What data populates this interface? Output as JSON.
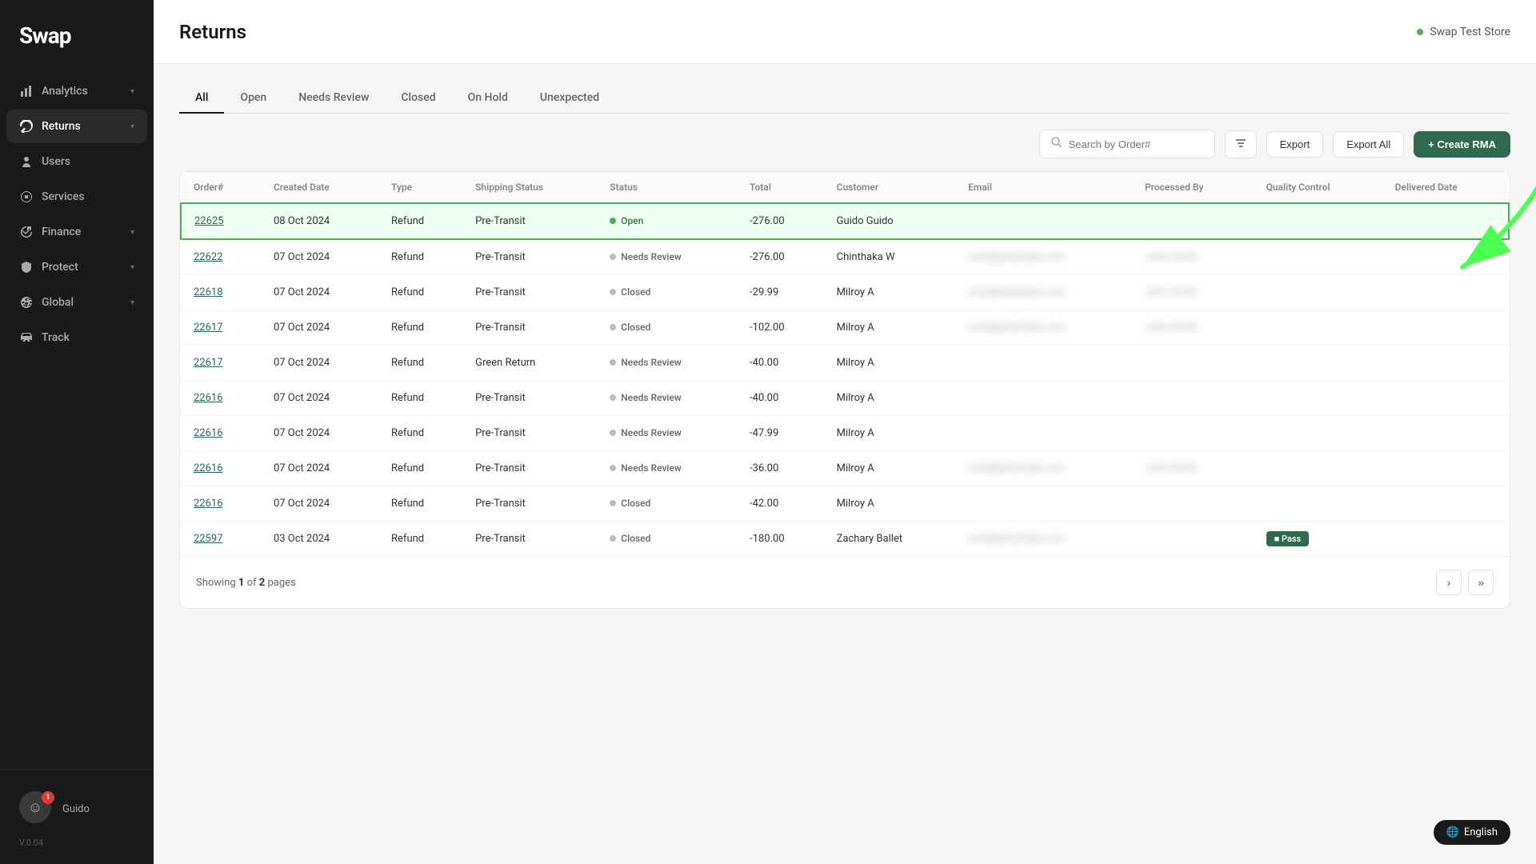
{
  "sidebar": {
    "logo": "Swap",
    "items": [
      {
        "id": "analytics",
        "label": "Analytics",
        "icon": "chart-bar",
        "hasChevron": true
      },
      {
        "id": "returns",
        "label": "Returns",
        "icon": "returns",
        "hasChevron": true,
        "active": true
      },
      {
        "id": "users",
        "label": "Users",
        "icon": "users",
        "hasChevron": false
      },
      {
        "id": "services",
        "label": "Services",
        "icon": "services",
        "hasChevron": false
      },
      {
        "id": "finance",
        "label": "Finance",
        "icon": "finance",
        "hasChevron": true
      },
      {
        "id": "protect",
        "label": "Protect",
        "icon": "shield",
        "hasChevron": true
      },
      {
        "id": "global",
        "label": "Global",
        "icon": "globe",
        "hasChevron": true
      },
      {
        "id": "track",
        "label": "Track",
        "icon": "track",
        "hasChevron": false
      }
    ],
    "user_name": "Guido",
    "version": "V.0.04"
  },
  "header": {
    "title": "Returns",
    "store_name": "Swap Test Store"
  },
  "tabs": [
    {
      "id": "all",
      "label": "All",
      "active": true
    },
    {
      "id": "open",
      "label": "Open",
      "active": false
    },
    {
      "id": "needs-review",
      "label": "Needs Review",
      "active": false
    },
    {
      "id": "closed",
      "label": "Closed",
      "active": false
    },
    {
      "id": "on-hold",
      "label": "On Hold",
      "active": false
    },
    {
      "id": "unexpected",
      "label": "Unexpected",
      "active": false
    }
  ],
  "toolbar": {
    "search_placeholder": "Search by Order#",
    "export_label": "Export",
    "export_all_label": "Export All",
    "create_rma_label": "+ Create RMA"
  },
  "table": {
    "columns": [
      "Order#",
      "Created Date",
      "Type",
      "Shipping Status",
      "Status",
      "Total",
      "Customer",
      "Email",
      "Processed By",
      "Quality Control",
      "Delivered Date"
    ],
    "rows": [
      {
        "order": "22625",
        "created_date": "08 Oct 2024",
        "type": "Refund",
        "shipping_status": "Pre-Transit",
        "status": "Open",
        "status_type": "open",
        "total": "-276.00",
        "customer": "Guido Guido",
        "email": "",
        "processed_by": "",
        "quality_control": "",
        "delivered_date": "",
        "highlighted": true
      },
      {
        "order": "22622",
        "created_date": "07 Oct 2024",
        "type": "Refund",
        "shipping_status": "Pre-Transit",
        "status": "Needs Review",
        "status_type": "needs-review",
        "total": "-276.00",
        "customer": "Chinthaka W",
        "email": "blurred",
        "processed_by": "blurred",
        "quality_control": "",
        "delivered_date": "",
        "highlighted": false
      },
      {
        "order": "22618",
        "created_date": "07 Oct 2024",
        "type": "Refund",
        "shipping_status": "Pre-Transit",
        "status": "Closed",
        "status_type": "closed",
        "total": "-29.99",
        "customer": "Milroy A",
        "email": "blurred",
        "processed_by": "blurred",
        "quality_control": "",
        "delivered_date": "",
        "highlighted": false
      },
      {
        "order": "22617",
        "created_date": "07 Oct 2024",
        "type": "Refund",
        "shipping_status": "Pre-Transit",
        "status": "Closed",
        "status_type": "closed",
        "total": "-102.00",
        "customer": "Milroy A",
        "email": "blurred",
        "processed_by": "blurred",
        "quality_control": "",
        "delivered_date": "",
        "highlighted": false
      },
      {
        "order": "22617",
        "created_date": "07 Oct 2024",
        "type": "Refund",
        "shipping_status": "Green Return",
        "status": "Needs Review",
        "status_type": "needs-review",
        "total": "-40.00",
        "customer": "Milroy A",
        "email": "",
        "processed_by": "",
        "quality_control": "",
        "delivered_date": "",
        "highlighted": false
      },
      {
        "order": "22616",
        "created_date": "07 Oct 2024",
        "type": "Refund",
        "shipping_status": "Pre-Transit",
        "status": "Needs Review",
        "status_type": "needs-review",
        "total": "-40.00",
        "customer": "Milroy A",
        "email": "",
        "processed_by": "",
        "quality_control": "",
        "delivered_date": "",
        "highlighted": false
      },
      {
        "order": "22616",
        "created_date": "07 Oct 2024",
        "type": "Refund",
        "shipping_status": "Pre-Transit",
        "status": "Needs Review",
        "status_type": "needs-review",
        "total": "-47.99",
        "customer": "Milroy A",
        "email": "",
        "processed_by": "",
        "quality_control": "",
        "delivered_date": "",
        "highlighted": false
      },
      {
        "order": "22616",
        "created_date": "07 Oct 2024",
        "type": "Refund",
        "shipping_status": "Pre-Transit",
        "status": "Needs Review",
        "status_type": "needs-review",
        "total": "-36.00",
        "customer": "Milroy A",
        "email": "blurred",
        "processed_by": "blurred",
        "quality_control": "",
        "delivered_date": "",
        "highlighted": false
      },
      {
        "order": "22616",
        "created_date": "07 Oct 2024",
        "type": "Refund",
        "shipping_status": "Pre-Transit",
        "status": "Closed",
        "status_type": "closed",
        "total": "-42.00",
        "customer": "Milroy A",
        "email": "",
        "processed_by": "",
        "quality_control": "",
        "delivered_date": "",
        "highlighted": false
      },
      {
        "order": "22597",
        "created_date": "03 Oct 2024",
        "type": "Refund",
        "shipping_status": "Pre-Transit",
        "status": "Closed",
        "status_type": "closed",
        "total": "-180.00",
        "customer": "Zachary Ballet",
        "email": "blurred",
        "processed_by": "",
        "quality_control": "Pass",
        "delivered_date": "",
        "highlighted": false
      }
    ]
  },
  "pagination": {
    "showing_text": "Showing",
    "current_page": "1",
    "of_text": "of",
    "total_pages": "2",
    "pages_text": "pages"
  },
  "footer": {
    "language": "English"
  }
}
